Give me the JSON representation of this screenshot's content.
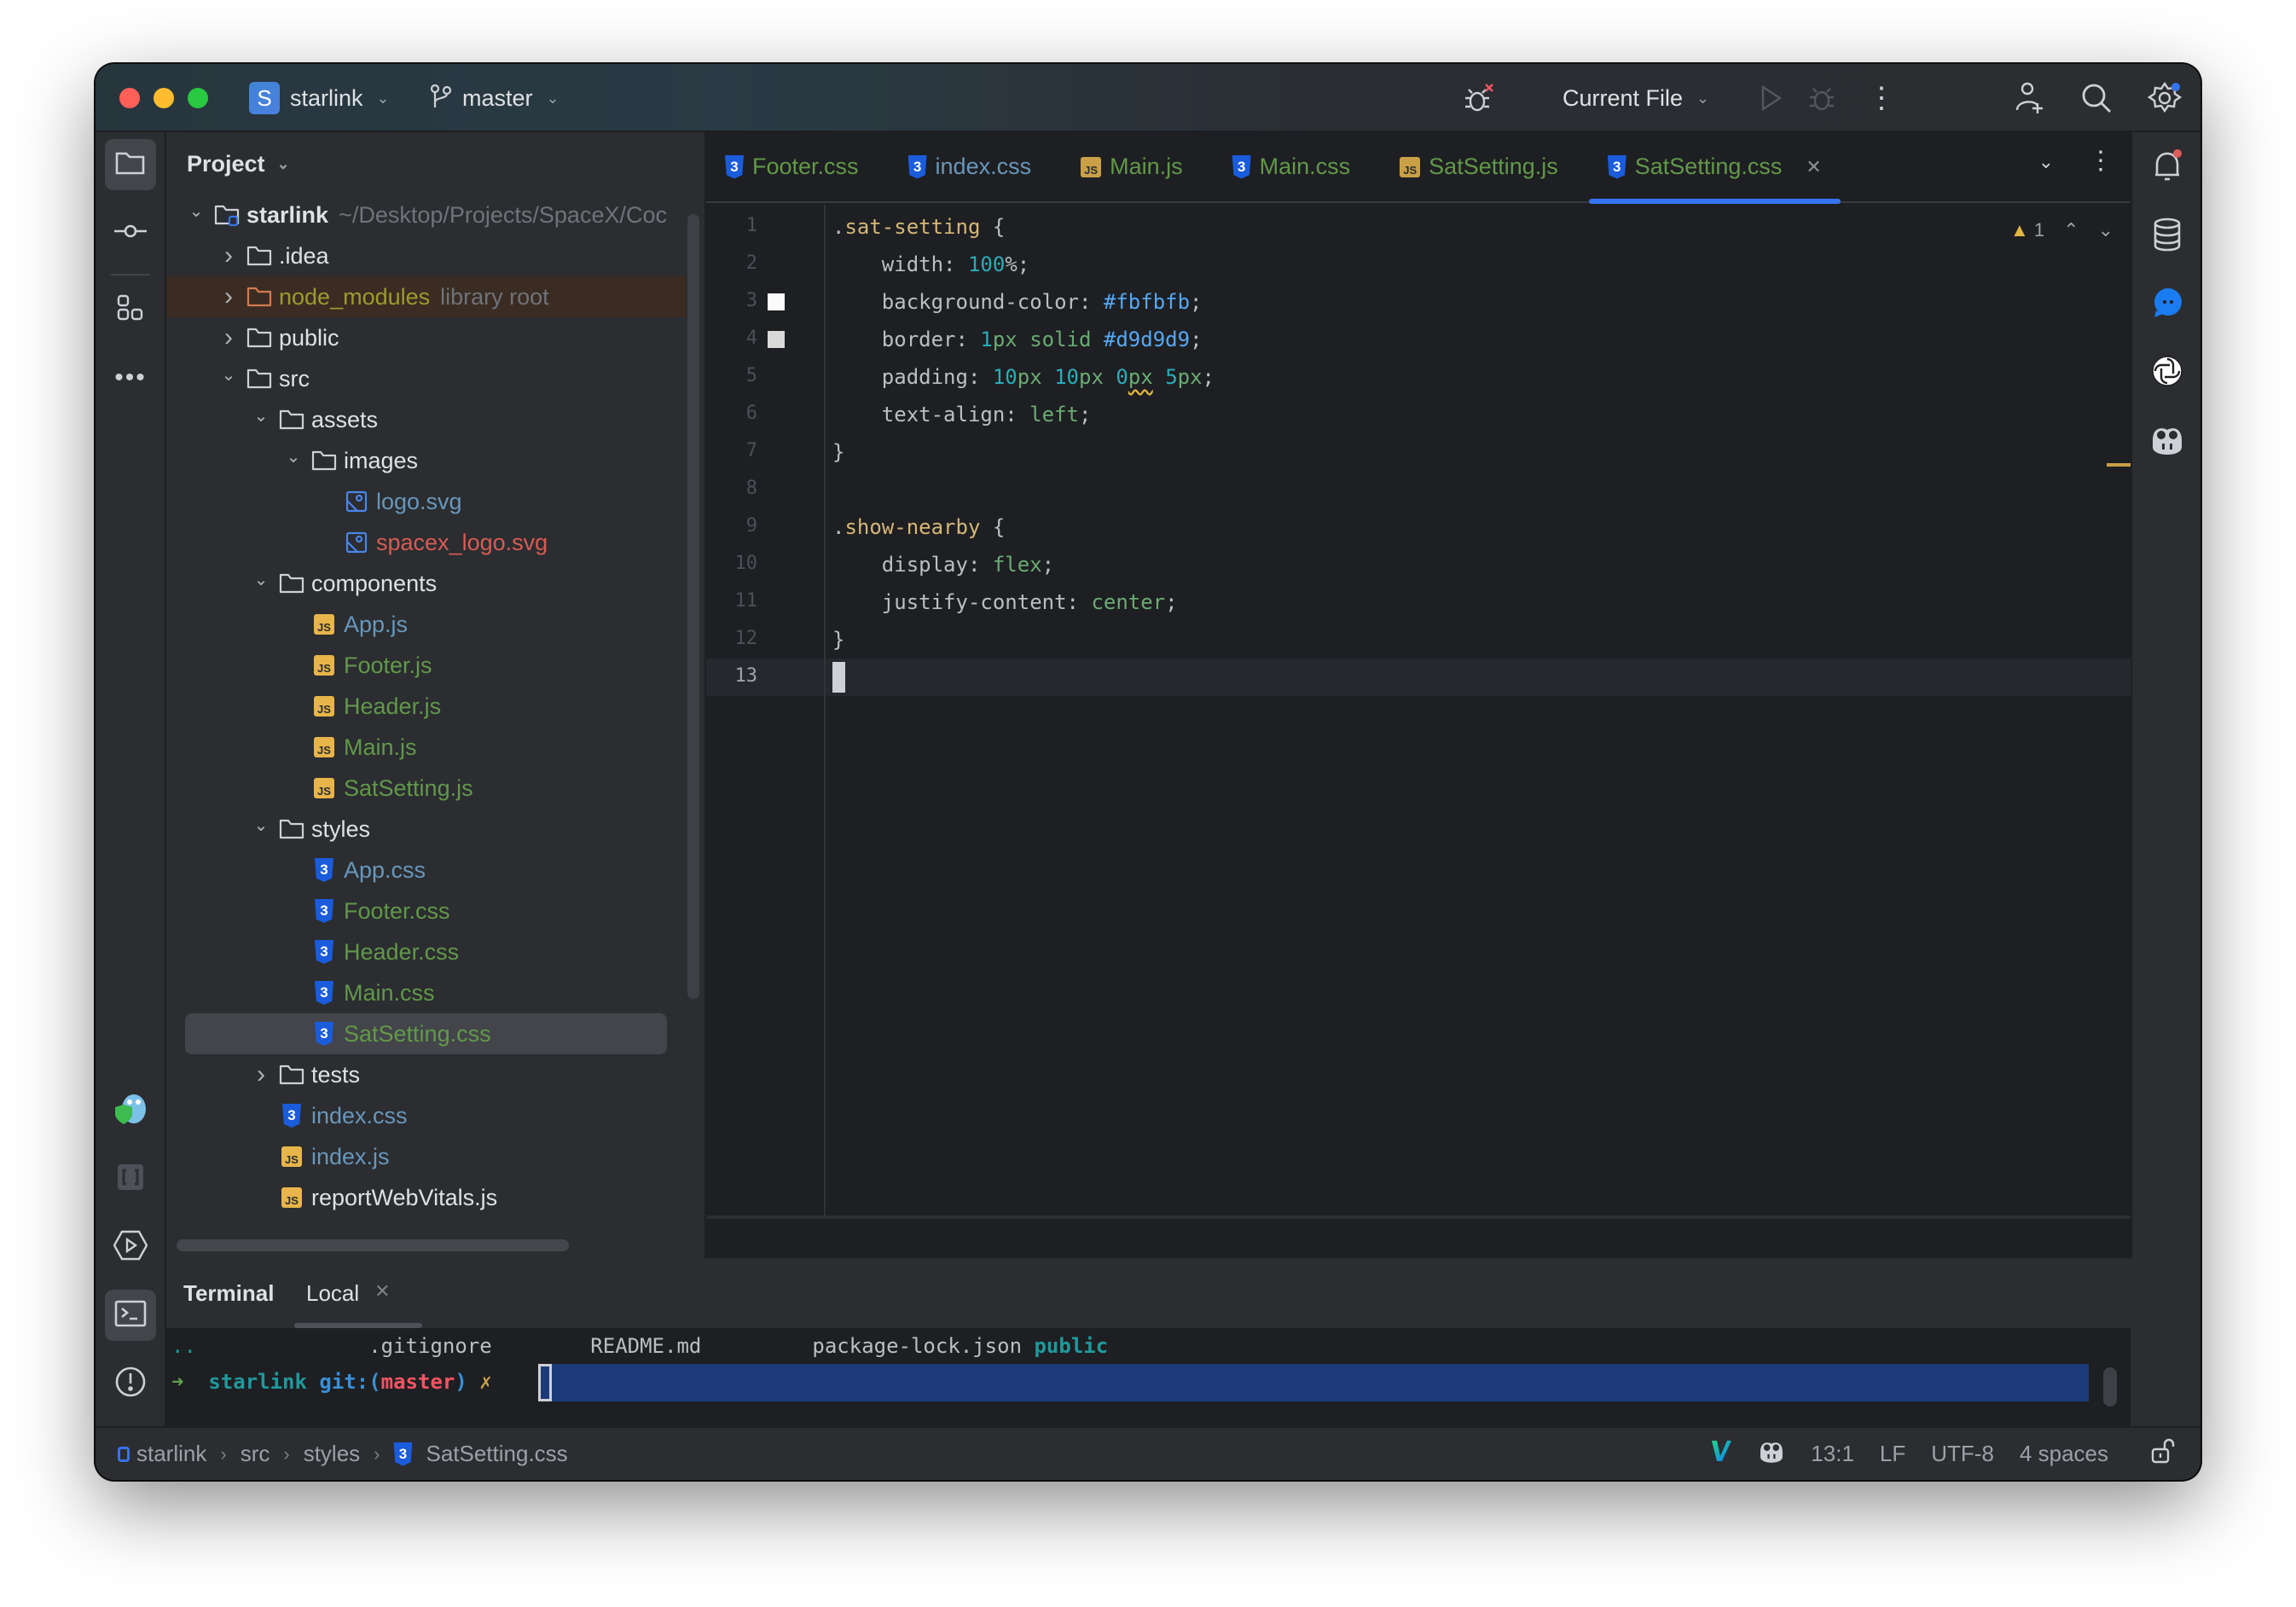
{
  "titlebar": {
    "project_badge": "S",
    "project_name": "starlink",
    "branch": "master",
    "run_config": "Current File"
  },
  "left_strip": {
    "items": [
      "project",
      "commit",
      "structure",
      "more"
    ],
    "bottom_items": [
      "gopher-plugin",
      "json-tool",
      "services",
      "terminal",
      "problems",
      "git"
    ]
  },
  "project_panel": {
    "title": "Project",
    "tree": [
      {
        "name": "starlink",
        "hint": "~/Desktop/Projects/SpaceX/Coc",
        "type": "project-root",
        "depth": 0,
        "expanded": true,
        "color": "default"
      },
      {
        "name": ".idea",
        "type": "folder",
        "depth": 1,
        "expanded": false,
        "color": "default"
      },
      {
        "name": "node_modules",
        "hint": "library root",
        "type": "folder-lib",
        "depth": 1,
        "expanded": false,
        "color": "olive"
      },
      {
        "name": "public",
        "type": "folder",
        "depth": 1,
        "expanded": false,
        "color": "default"
      },
      {
        "name": "src",
        "type": "folder",
        "depth": 1,
        "expanded": true,
        "color": "default"
      },
      {
        "name": "assets",
        "type": "folder",
        "depth": 2,
        "expanded": true,
        "color": "default"
      },
      {
        "name": "images",
        "type": "folder",
        "depth": 3,
        "expanded": true,
        "color": "default"
      },
      {
        "name": "logo.svg",
        "type": "image",
        "depth": 4,
        "color": "blue"
      },
      {
        "name": "spacex_logo.svg",
        "type": "image",
        "depth": 4,
        "color": "red"
      },
      {
        "name": "components",
        "type": "folder",
        "depth": 2,
        "expanded": true,
        "color": "default"
      },
      {
        "name": "App.js",
        "type": "js",
        "depth": 3,
        "color": "blue"
      },
      {
        "name": "Footer.js",
        "type": "js",
        "depth": 3,
        "color": "green"
      },
      {
        "name": "Header.js",
        "type": "js",
        "depth": 3,
        "color": "green"
      },
      {
        "name": "Main.js",
        "type": "js",
        "depth": 3,
        "color": "green"
      },
      {
        "name": "SatSetting.js",
        "type": "js",
        "depth": 3,
        "color": "green"
      },
      {
        "name": "styles",
        "type": "folder",
        "depth": 2,
        "expanded": true,
        "color": "default"
      },
      {
        "name": "App.css",
        "type": "css",
        "depth": 3,
        "color": "blue"
      },
      {
        "name": "Footer.css",
        "type": "css",
        "depth": 3,
        "color": "green"
      },
      {
        "name": "Header.css",
        "type": "css",
        "depth": 3,
        "color": "green"
      },
      {
        "name": "Main.css",
        "type": "css",
        "depth": 3,
        "color": "green"
      },
      {
        "name": "SatSetting.css",
        "type": "css",
        "depth": 3,
        "color": "green",
        "selected": true
      },
      {
        "name": "tests",
        "type": "folder",
        "depth": 2,
        "expanded": false,
        "color": "default"
      },
      {
        "name": "index.css",
        "type": "css",
        "depth": 2,
        "color": "blue"
      },
      {
        "name": "index.js",
        "type": "js",
        "depth": 2,
        "color": "blue"
      },
      {
        "name": "reportWebVitals.js",
        "type": "js",
        "depth": 2,
        "color": "default"
      }
    ]
  },
  "editor": {
    "tabs": [
      {
        "label": "Footer.css",
        "type": "css",
        "color": "green"
      },
      {
        "label": "index.css",
        "type": "css",
        "color": "blue"
      },
      {
        "label": "Main.js",
        "type": "js",
        "color": "green"
      },
      {
        "label": "Main.css",
        "type": "css",
        "color": "green"
      },
      {
        "label": "SatSetting.js",
        "type": "js",
        "color": "green"
      },
      {
        "label": "SatSetting.css",
        "type": "css",
        "color": "green",
        "active": true
      }
    ],
    "warning_count": "1",
    "current_line": 13,
    "lines": [
      {
        "n": "1",
        "tokens": [
          [
            "",
            "."
          ],
          [
            "sel",
            "sat-setting"
          ],
          [
            "",
            " {"
          ]
        ]
      },
      {
        "n": "2",
        "tokens": [
          [
            "",
            "    width: "
          ],
          [
            "num",
            "100"
          ],
          [
            "",
            "%;"
          ]
        ]
      },
      {
        "n": "3",
        "swatch": "#fbfbfb",
        "tokens": [
          [
            "",
            "    background-color: "
          ],
          [
            "color",
            "#fbfbfb"
          ],
          [
            "",
            ";"
          ]
        ]
      },
      {
        "n": "4",
        "swatch": "#d9d9d9",
        "tokens": [
          [
            "",
            "    border: "
          ],
          [
            "num",
            "1"
          ],
          [
            "unit",
            "px"
          ],
          [
            "kw",
            " solid "
          ],
          [
            "color",
            "#d9d9d9"
          ],
          [
            "",
            ";"
          ]
        ]
      },
      {
        "n": "5",
        "tokens": [
          [
            "",
            "    padding: "
          ],
          [
            "num",
            "10"
          ],
          [
            "unit",
            "px"
          ],
          [
            "",
            " "
          ],
          [
            "num",
            "10"
          ],
          [
            "unit",
            "px"
          ],
          [
            "",
            " "
          ],
          [
            "num",
            "0"
          ],
          [
            "unitwarn",
            "px"
          ],
          [
            "",
            " "
          ],
          [
            "num",
            "5"
          ],
          [
            "unit",
            "px"
          ],
          [
            "",
            ";"
          ]
        ]
      },
      {
        "n": "6",
        "tokens": [
          [
            "",
            "    text-align: "
          ],
          [
            "kw",
            "left"
          ],
          [
            "",
            ";"
          ]
        ]
      },
      {
        "n": "7",
        "tokens": [
          [
            "",
            "}"
          ]
        ]
      },
      {
        "n": "8",
        "tokens": []
      },
      {
        "n": "9",
        "tokens": [
          [
            "",
            "."
          ],
          [
            "sel",
            "show-nearby"
          ],
          [
            "",
            " {"
          ]
        ]
      },
      {
        "n": "10",
        "tokens": [
          [
            "",
            "    display: "
          ],
          [
            "kw",
            "flex"
          ],
          [
            "",
            ";"
          ]
        ]
      },
      {
        "n": "11",
        "tokens": [
          [
            "",
            "    justify-content: "
          ],
          [
            "kw",
            "center"
          ],
          [
            "",
            ";"
          ]
        ]
      },
      {
        "n": "12",
        "tokens": [
          [
            "",
            "}"
          ]
        ]
      },
      {
        "n": "13",
        "tokens": [],
        "caret": true
      }
    ]
  },
  "terminal": {
    "title": "Terminal",
    "tab": "Local",
    "listing": [
      "..",
      ".gitignore",
      "README.md",
      "package-lock.json",
      "public"
    ],
    "prompt": {
      "arrow": "➜",
      "dir": "starlink",
      "git_prefix": "git:(",
      "branch": "master",
      "git_suffix": ")",
      "dirty": "✗"
    }
  },
  "statusbar": {
    "breadcrumbs": [
      "starlink",
      "src",
      "styles",
      "SatSetting.css"
    ],
    "position": "13:1",
    "line_ending": "LF",
    "encoding": "UTF-8",
    "indent": "4 spaces"
  },
  "colors": {
    "accent": "#3574f0",
    "selector": "#d5b778",
    "number": "#2aacb8",
    "keyword": "#6aab73",
    "color_value": "#56a8f5",
    "warning": "#e0b542"
  }
}
